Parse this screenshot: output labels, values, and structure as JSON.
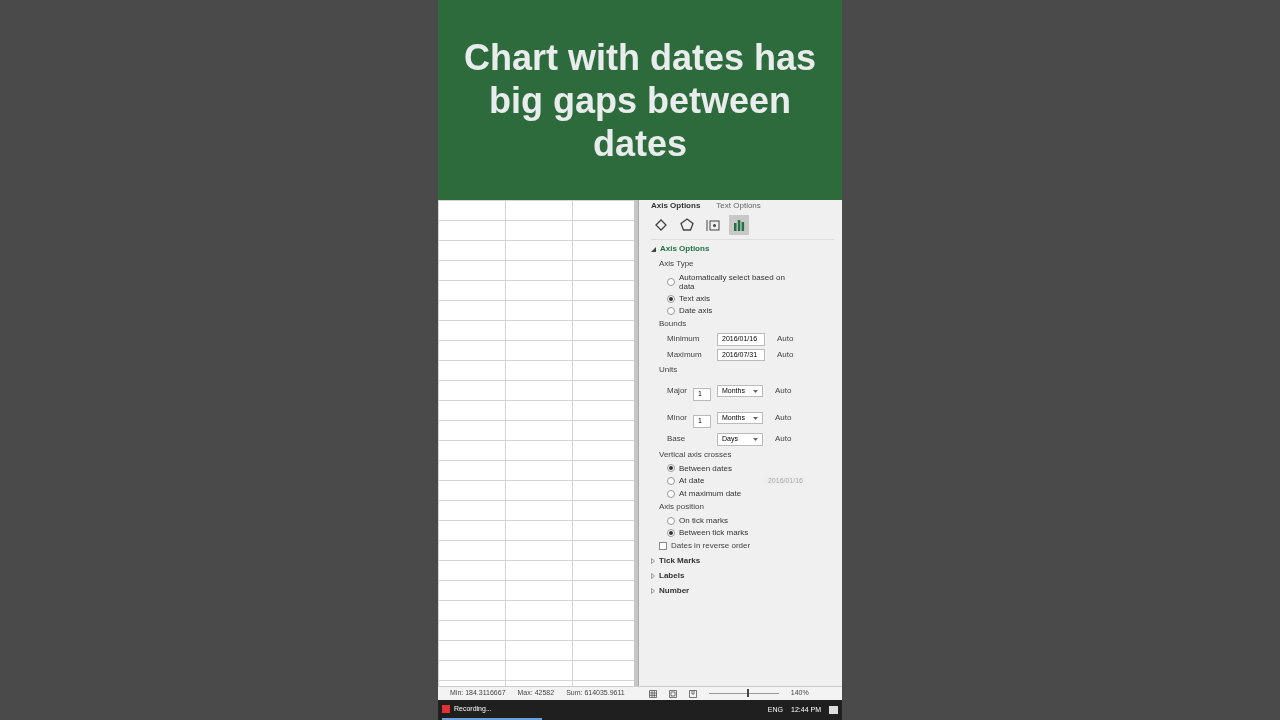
{
  "title": "Chart with dates has big gaps between dates",
  "pane": {
    "tabs": [
      {
        "label": "Axis Options",
        "selected": true
      },
      {
        "label": "Text Options",
        "selected": false
      }
    ],
    "icons": [
      {
        "kind": "fill",
        "selected": false
      },
      {
        "kind": "effects",
        "selected": false
      },
      {
        "kind": "size",
        "selected": false
      },
      {
        "kind": "axis",
        "selected": true
      }
    ],
    "section": "Axis Options",
    "axis_type": {
      "label": "Axis Type",
      "options": [
        {
          "label": "Automatically select based on data",
          "selected": false
        },
        {
          "label": "Text axis",
          "selected": true
        },
        {
          "label": "Date axis",
          "selected": false
        }
      ]
    },
    "bounds": {
      "label": "Bounds",
      "rows": [
        {
          "label": "Minimum",
          "value": "2016/01/16",
          "auto": "Auto"
        },
        {
          "label": "Maximum",
          "value": "2016/07/31",
          "auto": "Auto"
        }
      ]
    },
    "units": {
      "label": "Units",
      "rows": [
        {
          "label": "Major",
          "number": "1",
          "unit": "Months",
          "auto": "Auto"
        },
        {
          "label": "Minor",
          "number": "1",
          "unit": "Months",
          "auto": "Auto"
        },
        {
          "label": "Base",
          "unit": "Days",
          "auto": "Auto"
        }
      ]
    },
    "crosses": {
      "label": "Vertical axis crosses",
      "options": [
        {
          "label": "Between dates",
          "selected": true
        },
        {
          "label": "At date",
          "selected": false,
          "value": "2016/01/16"
        },
        {
          "label": "At maximum date",
          "selected": false
        }
      ]
    },
    "position": {
      "label": "Axis position",
      "options": [
        {
          "label": "On tick marks",
          "selected": false
        },
        {
          "label": "Between tick marks",
          "selected": true
        }
      ]
    },
    "reverse": {
      "label": "Dates in reverse order",
      "checked": false
    },
    "collapsed": [
      {
        "label": "Tick Marks"
      },
      {
        "label": "Labels"
      },
      {
        "label": "Number"
      }
    ]
  },
  "status_bar": {
    "stats": [
      "Min: 184.3116667",
      "Max: 42582",
      "Sum: 614035.9611"
    ],
    "zoom": "140%",
    "level": 0.55
  },
  "taskbar": {
    "app": "Recording...",
    "language": "ENG",
    "time": "12:44 PM"
  }
}
